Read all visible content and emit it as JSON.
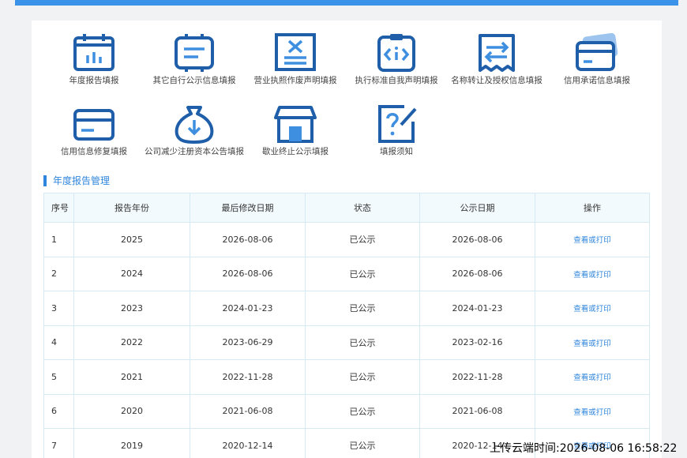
{
  "colors": {
    "accent": "#2f86dc",
    "icon_dark": "#1f5ea8",
    "icon_light": "#3f8fe0",
    "topbar": "#3a93e8"
  },
  "tiles": [
    {
      "label": "年度报告填报",
      "icon": "calendar-chart-icon"
    },
    {
      "label": "其它自行公示信息填报",
      "icon": "document-list-icon"
    },
    {
      "label": "营业执照作废声明填报",
      "icon": "license-void-icon"
    },
    {
      "label": "执行标准自我声明填报",
      "icon": "clipboard-code-icon"
    },
    {
      "label": "名称转让及授权信息填报",
      "icon": "transfer-arrows-icon"
    },
    {
      "label": "信用承诺信息填报",
      "icon": "credit-card-icon"
    },
    {
      "label": "信用信息修复填报",
      "icon": "card-repair-icon"
    },
    {
      "label": "公司减少注册资本公告填报",
      "icon": "money-bag-down-icon"
    },
    {
      "label": "歇业终止公示填报",
      "icon": "shop-closed-icon"
    },
    {
      "label": "填报须知",
      "icon": "question-pen-icon"
    }
  ],
  "section": {
    "title": "年度报告管理"
  },
  "table": {
    "headers": [
      "序号",
      "报告年份",
      "最后修改日期",
      "状态",
      "公示日期",
      "操作"
    ],
    "rows": [
      [
        "1",
        "2025",
        "2026-08-06",
        "已公示",
        "2026-08-06",
        "查看或打印"
      ],
      [
        "2",
        "2024",
        "2026-08-06",
        "已公示",
        "2026-08-06",
        "查看或打印"
      ],
      [
        "3",
        "2023",
        "2024-01-23",
        "已公示",
        "2024-01-23",
        "查看或打印"
      ],
      [
        "4",
        "2022",
        "2023-06-29",
        "已公示",
        "2023-02-16",
        "查看或打印"
      ],
      [
        "5",
        "2021",
        "2022-11-28",
        "已公示",
        "2022-11-28",
        "查看或打印"
      ],
      [
        "6",
        "2020",
        "2021-06-08",
        "已公示",
        "2021-06-08",
        "查看或打印"
      ],
      [
        "7",
        "2019",
        "2020-12-14",
        "已公示",
        "2020-12-14",
        "查看或打印"
      ]
    ]
  },
  "overlay": {
    "timestamp": "上传云端时间:2026-08-06 16:58:22"
  }
}
